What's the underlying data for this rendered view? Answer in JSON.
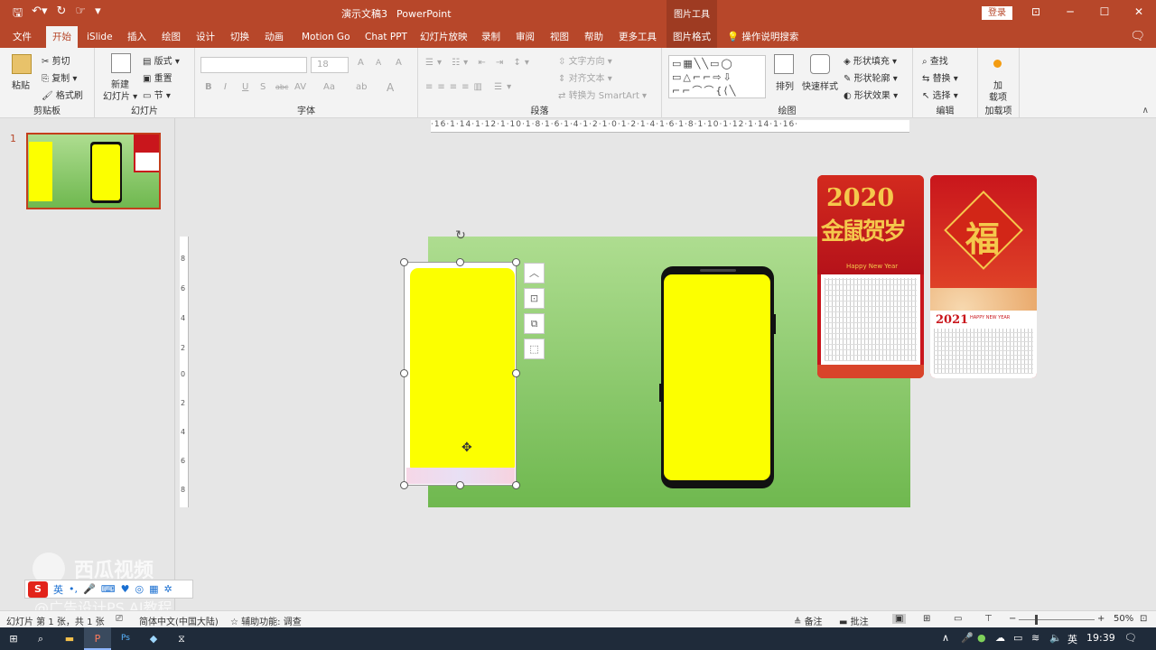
{
  "titlebar": {
    "doc_title": "演示文稿3",
    "app_name": "PowerPoint",
    "context_tools": "图片工具",
    "login": "登录",
    "min": "─",
    "max": "☐",
    "close": "✕",
    "ribbon_display": "⊡",
    "qat": [
      "save-icon",
      "undo-icon",
      "redo-icon",
      "touch-mode-icon",
      "customize-icon"
    ]
  },
  "menu": {
    "tabs": [
      "文件",
      "开始",
      "iSlide",
      "插入",
      "绘图",
      "设计",
      "切换",
      "动画",
      "Motion Go",
      "Chat PPT",
      "幻灯片放映",
      "录制",
      "审阅",
      "视图",
      "帮助",
      "更多工具",
      "图片格式"
    ],
    "active": "开始",
    "tell_me": "操作说明搜索"
  },
  "ribbon": {
    "clipboard": {
      "label": "剪贴板",
      "paste": "粘贴",
      "cut": "剪切",
      "copy": "复制",
      "format_painter": "格式刷"
    },
    "slides": {
      "label": "幻灯片",
      "new_slide": "新建",
      "new_slide2": "幻灯片",
      "layout": "版式",
      "reset": "重置",
      "section": "节"
    },
    "font": {
      "label": "字体",
      "font_name": "",
      "font_size": "18",
      "bold": "B",
      "italic": "I",
      "underline": "U",
      "shadow": "S",
      "strike": "abc",
      "spacing": "AV",
      "case": "Aa",
      "highlight": "ab",
      "color": "A",
      "grow": "A",
      "shrink": "A",
      "clear": "A"
    },
    "paragraph": {
      "label": "段落",
      "text_direction": "文字方向",
      "align_text": "对齐文本",
      "smartart": "转换为 SmartArt"
    },
    "drawing": {
      "label": "绘图",
      "shapes_glyphs": "▭▦╲╲▭◯\n▭△⌐⌐⇨⇩\n⌐⌐⌒⌒{⟨╲",
      "arrange": "排列",
      "quick_styles": "快速样式",
      "fill": "形状填充",
      "outline": "形状轮廓",
      "effects": "形状效果"
    },
    "editing": {
      "label": "编辑",
      "find": "查找",
      "replace": "替换",
      "select": "选择"
    },
    "addins": {
      "label": "加载项",
      "addin": "加",
      "addin2": "载项"
    }
  },
  "left_pane": {
    "slide_number": "1"
  },
  "rulers": {
    "horizontal": "·16·1·14·1·12·1·10·1·8·1·6·1·4·1·2·1·0·1·2·1·4·1·6·1·8·1·10·1·12·1·14·1·16·",
    "vertical": [
      "8",
      "6",
      "4",
      "2",
      "0",
      "2",
      "4",
      "6",
      "8"
    ]
  },
  "slide": {
    "card1_title": "2020",
    "card1_subtitle": "金鼠贺岁",
    "card1_tagline": "Happy New Year",
    "card2_glyph": "福",
    "card2_year": "2021",
    "card2_tagline": "HAPPY NEW YEAR"
  },
  "float_tools": [
    "chevron-up-icon",
    "layout-options-icon",
    "layer-icon",
    "crop-icon"
  ],
  "watermark": {
    "brand": "西瓜视频",
    "account": "@广告设计PS AI教程"
  },
  "ime": {
    "lang": "英",
    "brand": "S"
  },
  "status": {
    "slide_info": "幻灯片 第 1 张，共 1 张",
    "language": "简体中文(中国大陆)",
    "accessibility": "辅助功能: 调查",
    "notes": "备注",
    "comments": "批注",
    "zoom": "50%",
    "zoom_minus": "−",
    "zoom_plus": "+"
  },
  "taskbar": {
    "time": "19:39",
    "ime": "英",
    "apps": [
      "start-icon",
      "search-icon",
      "file-explorer-icon",
      "powerpoint-icon",
      "photoshop-icon",
      "app-icon",
      "capcut-icon"
    ]
  },
  "colors": {
    "brand": "#b7472a",
    "context_tab": "#9e3b22",
    "slide_green_top": "#aedd90",
    "slide_green_bottom": "#6fb84f",
    "screen_yellow": "#fcff00",
    "card_red": "#c9161c",
    "gold": "#f5c84c"
  }
}
